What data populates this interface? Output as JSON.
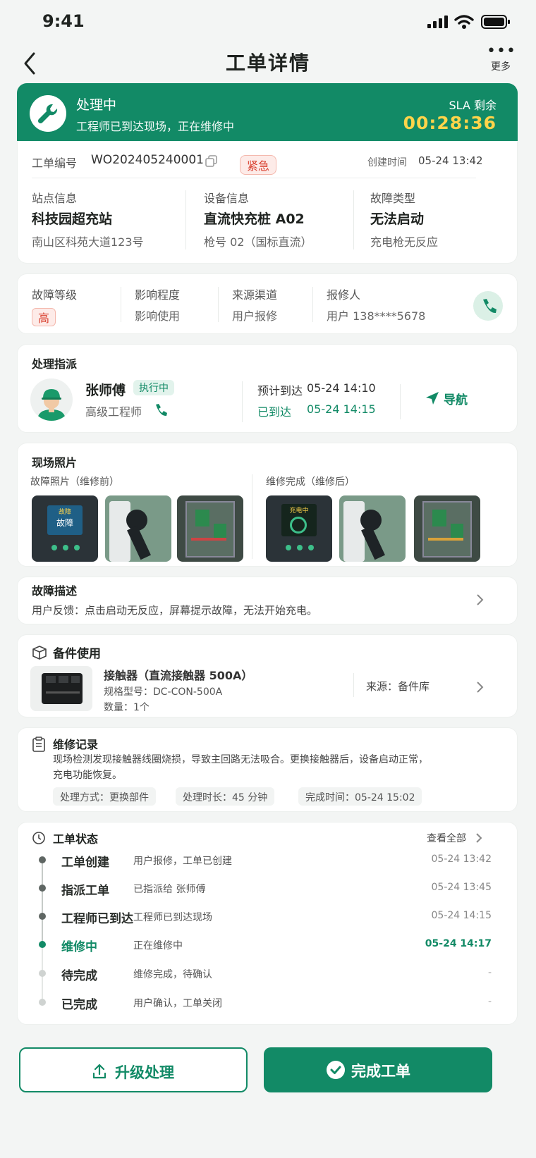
{
  "status_bar": {
    "time": "9:41"
  },
  "nav": {
    "title": "工单详情",
    "more_label": "更多"
  },
  "banner": {
    "title": "处理中",
    "subtitle": "工程师已到达现场，正在维修中",
    "sla_label": "SLA 剩余",
    "sla_value": "00:28:36"
  },
  "order": {
    "no_label": "工单编号",
    "no_value": "WO202405240001",
    "urgency": "紧急",
    "created_label": "创建时间",
    "created_value": "05-24 13:42"
  },
  "info": [
    {
      "label": "站点信息",
      "value": "科技园超充站",
      "sub": "南山区科苑大道123号"
    },
    {
      "label": "设备信息",
      "value": "直流快充桩 A02",
      "sub": "枪号 02（国标直流）"
    },
    {
      "label": "故障类型",
      "value": "无法启动",
      "sub": "充电枪无反应"
    }
  ],
  "fault": {
    "level_label": "故障等级",
    "level_value": "高",
    "impact_label": "影响程度",
    "impact_value": "影响使用",
    "source_label": "来源渠道",
    "source_value": "用户报修",
    "reporter_label": "报修人",
    "reporter_value": "用户 138****5678"
  },
  "assign": {
    "section_title": "处理指派",
    "name": "张师傅",
    "status": "执行中",
    "role": "高级工程师",
    "eta_label": "预计到达",
    "eta_value": "05-24 14:10",
    "arrived_label": "已到达",
    "arrived_value": "05-24 14:15",
    "nav_label": "导航"
  },
  "photos": {
    "section_title": "现场照片",
    "before_label": "故障照片（维修前）",
    "after_label": "维修完成（维修后）",
    "screen_before": "故障",
    "screen_before_top": "故障",
    "screen_after": "充电中"
  },
  "desc": {
    "title": "故障描述",
    "text": "用户反馈：点击启动无反应，屏幕提示故障，无法开始充电。"
  },
  "parts": {
    "title": "备件使用",
    "name": "接触器（直流接触器 500A）",
    "spec": "规格型号：DC-CON-500A",
    "qty": "数量：1个",
    "source": "来源：备件库"
  },
  "repair": {
    "title": "维修记录",
    "text1": "现场检测发现接触器线圈烧损，导致主回路无法吸合。更换接触器后，设备启动正常，",
    "text2": "充电功能恢复。",
    "chips": [
      "处理方式：更换部件",
      "处理时长：45 分钟",
      "完成时间：05-24 15:02"
    ]
  },
  "timeline": {
    "title": "工单状态",
    "view_all": "查看全部",
    "items": [
      {
        "name": "工单创建",
        "desc": "用户报修，工单已创建",
        "time": "05-24 13:42",
        "state": "done"
      },
      {
        "name": "指派工单",
        "desc": "已指派给 张师傅",
        "time": "05-24 13:45",
        "state": "done"
      },
      {
        "name": "工程师已到达",
        "desc": "工程师已到达现场",
        "time": "05-24 14:15",
        "state": "done"
      },
      {
        "name": "维修中",
        "desc": "正在维修中",
        "time": "05-24 14:17",
        "state": "active"
      },
      {
        "name": "待完成",
        "desc": "维修完成，待确认",
        "time": "-",
        "state": "pending"
      },
      {
        "name": "已完成",
        "desc": "用户确认，工单关闭",
        "time": "-",
        "state": "pending"
      }
    ]
  },
  "actions": {
    "escalate": "升级处理",
    "complete": "完成工单"
  },
  "colors": {
    "primary": "#128a66",
    "sla": "#ffd44a",
    "urgent": "#d9402f"
  }
}
